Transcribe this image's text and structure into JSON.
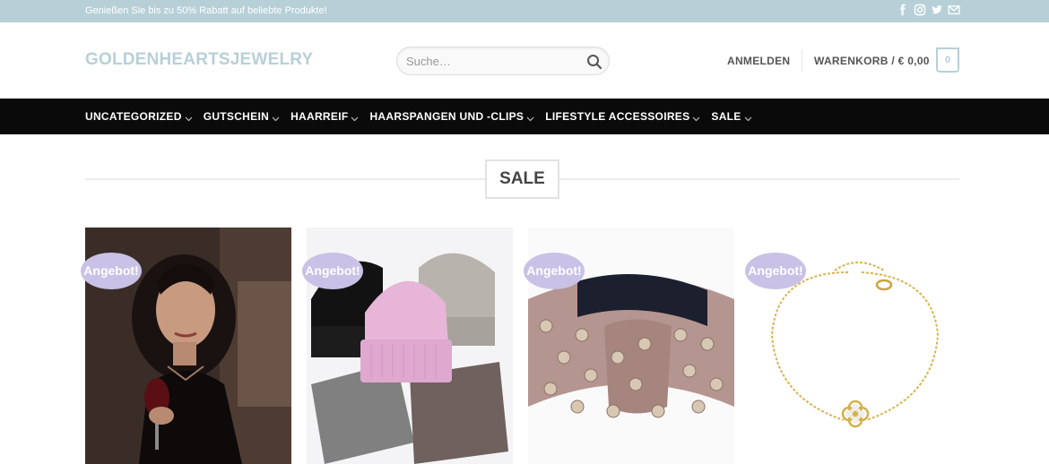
{
  "topbar": {
    "promo_text": "Genießen Sie bis zu 50% Rabatt auf beliebte Produkte!",
    "social_icons": [
      "facebook-icon",
      "instagram-icon",
      "twitter-icon",
      "email-icon"
    ]
  },
  "header": {
    "logo": "GOLDENHEARTSJEWELRY",
    "search_placeholder": "Suche…",
    "login_label": "ANMELDEN",
    "cart_label": "WARENKORB / € 0,00",
    "cart_count": "0"
  },
  "nav": {
    "items": [
      {
        "label": "UNCATEGORIZED"
      },
      {
        "label": "GUTSCHEIN"
      },
      {
        "label": "HAARREIF"
      },
      {
        "label": "HAARSPANGEN UND -CLIPS"
      },
      {
        "label": "LIFESTYLE ACCESSOIRES"
      },
      {
        "label": "SALE"
      }
    ]
  },
  "section": {
    "title": "SALE"
  },
  "products": [
    {
      "badge": "Angebot!"
    },
    {
      "badge": "Angebot!"
    },
    {
      "badge": "Angebot!"
    },
    {
      "badge": "Angebot!"
    }
  ],
  "colors": {
    "accent": "#b7d0d8",
    "nav_bg": "#0a0a0a",
    "badge_bg": "#c9c1e6"
  }
}
